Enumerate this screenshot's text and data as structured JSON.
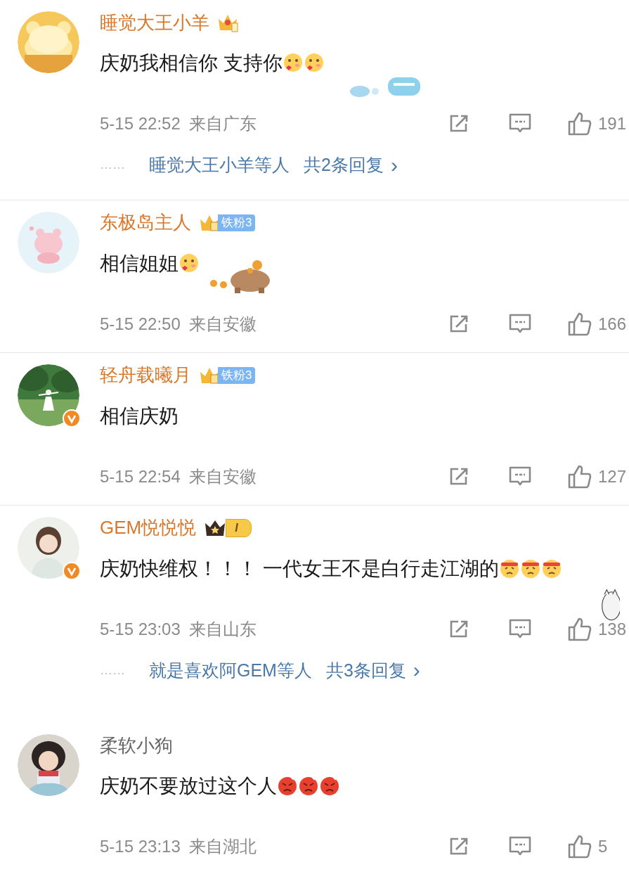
{
  "comments": [
    {
      "name": "睡觉大王小羊",
      "vip": true,
      "badge": {
        "kind": "crown"
      },
      "verified": false,
      "text": "庆奶我相信你 支持你",
      "emojis": [
        {
          "kind": "blush"
        },
        {
          "kind": "blush"
        }
      ],
      "sticker": {
        "kind": "sfj"
      },
      "time": "5-15 22:52",
      "location": "来自广东",
      "likes": "191",
      "replies": {
        "dots": "……",
        "users": "睡觉大王小羊等人",
        "count": "共2条回复",
        "arrow": "›"
      }
    },
    {
      "name": "东极岛主人",
      "vip": true,
      "badge": {
        "kind": "fan",
        "label": "铁粉3"
      },
      "verified": false,
      "text": "相信姐姐",
      "emojis": [
        {
          "kind": "blush"
        }
      ],
      "sticker": {
        "kind": "capybara"
      },
      "time": "5-15 22:50",
      "location": "来自安徽",
      "likes": "166"
    },
    {
      "name": "轻舟载曦月",
      "vip": true,
      "badge": {
        "kind": "fan",
        "label": "铁粉3"
      },
      "verified": true,
      "text": "相信庆奶",
      "time": "5-15 22:54",
      "location": "来自安徽",
      "likes": "127"
    },
    {
      "name": "GEM悦悦悦",
      "vip": true,
      "badge": {
        "kind": "level",
        "label": "I"
      },
      "verified": true,
      "text": "庆奶快维权！！！ 一代女王不是白行走江湖的",
      "emojis": [
        {
          "kind": "fired"
        },
        {
          "kind": "fired"
        },
        {
          "kind": "fired"
        }
      ],
      "sticker": {
        "kind": "cat"
      },
      "time": "5-15 23:03",
      "location": "来自山东",
      "likes": "138",
      "replies": {
        "dots": "……",
        "users": "就是喜欢阿GEM等人",
        "count": "共3条回复",
        "arrow": "›"
      }
    },
    {
      "name": "柔软小狗",
      "vip": false,
      "verified": false,
      "text": "庆奶不要放过这个人",
      "emojis": [
        {
          "kind": "angry"
        },
        {
          "kind": "angry"
        },
        {
          "kind": "angry"
        }
      ],
      "time": "5-15 23:13",
      "location": "来自湖北",
      "likes": "5"
    }
  ]
}
